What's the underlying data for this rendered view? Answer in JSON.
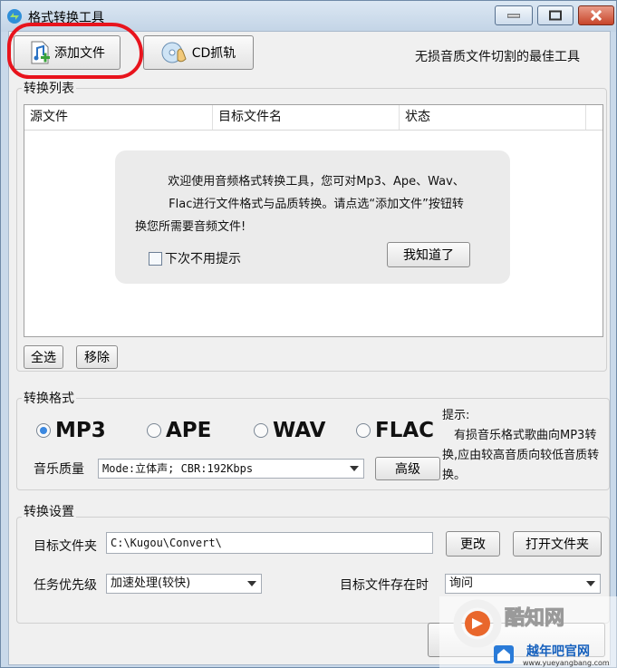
{
  "window": {
    "title": "格式转换工具"
  },
  "toolbar": {
    "add_file_label": "添加文件",
    "cd_rip_label": "CD抓轨",
    "slogan": "无损音质文件切割的最佳工具"
  },
  "list_section": {
    "title": "转换列表",
    "columns": [
      "源文件",
      "目标文件名",
      "状态"
    ],
    "popup": {
      "line1": "欢迎使用音频格式转换工具，您可对Mp3、Ape、Wav、",
      "line2": "Flac进行文件格式与品质转换。请点选“添加文件”按钮转",
      "line3": "换您所需要音频文件!",
      "dont_remind_label": "下次不用提示",
      "dont_remind_checked": false,
      "ok_label": "我知道了"
    },
    "select_all_label": "全选",
    "remove_label": "移除"
  },
  "format_section": {
    "title": "转换格式",
    "formats": [
      "MP3",
      "APE",
      "WAV",
      "FLAC"
    ],
    "selected": "MP3",
    "quality_label": "音乐质量",
    "quality_value": "Mode:立体声; CBR:192Kbps",
    "advanced_label": "高级",
    "hint_title": "提示:",
    "hint_body": "有损音乐格式歌曲向MP3转换,应由较高音质向较低音质转换。"
  },
  "settings_section": {
    "title": "转换设置",
    "target_folder_label": "目标文件夹",
    "target_folder_value": "C:\\Kugou\\Convert\\",
    "change_label": "更改",
    "open_folder_label": "打开文件夹",
    "priority_label": "任务优先级",
    "priority_value": "加速处理(较快)",
    "exists_label": "目标文件存在时",
    "exists_value": "询问"
  },
  "watermark": {
    "brand": "酷知网",
    "site_name": "越年吧官网",
    "site_url": "www.yueyangbang.com"
  },
  "colors": {
    "accent": "#3b88e0",
    "annotation_red": "#e8141d",
    "title_bar": "#c9d9ea"
  }
}
